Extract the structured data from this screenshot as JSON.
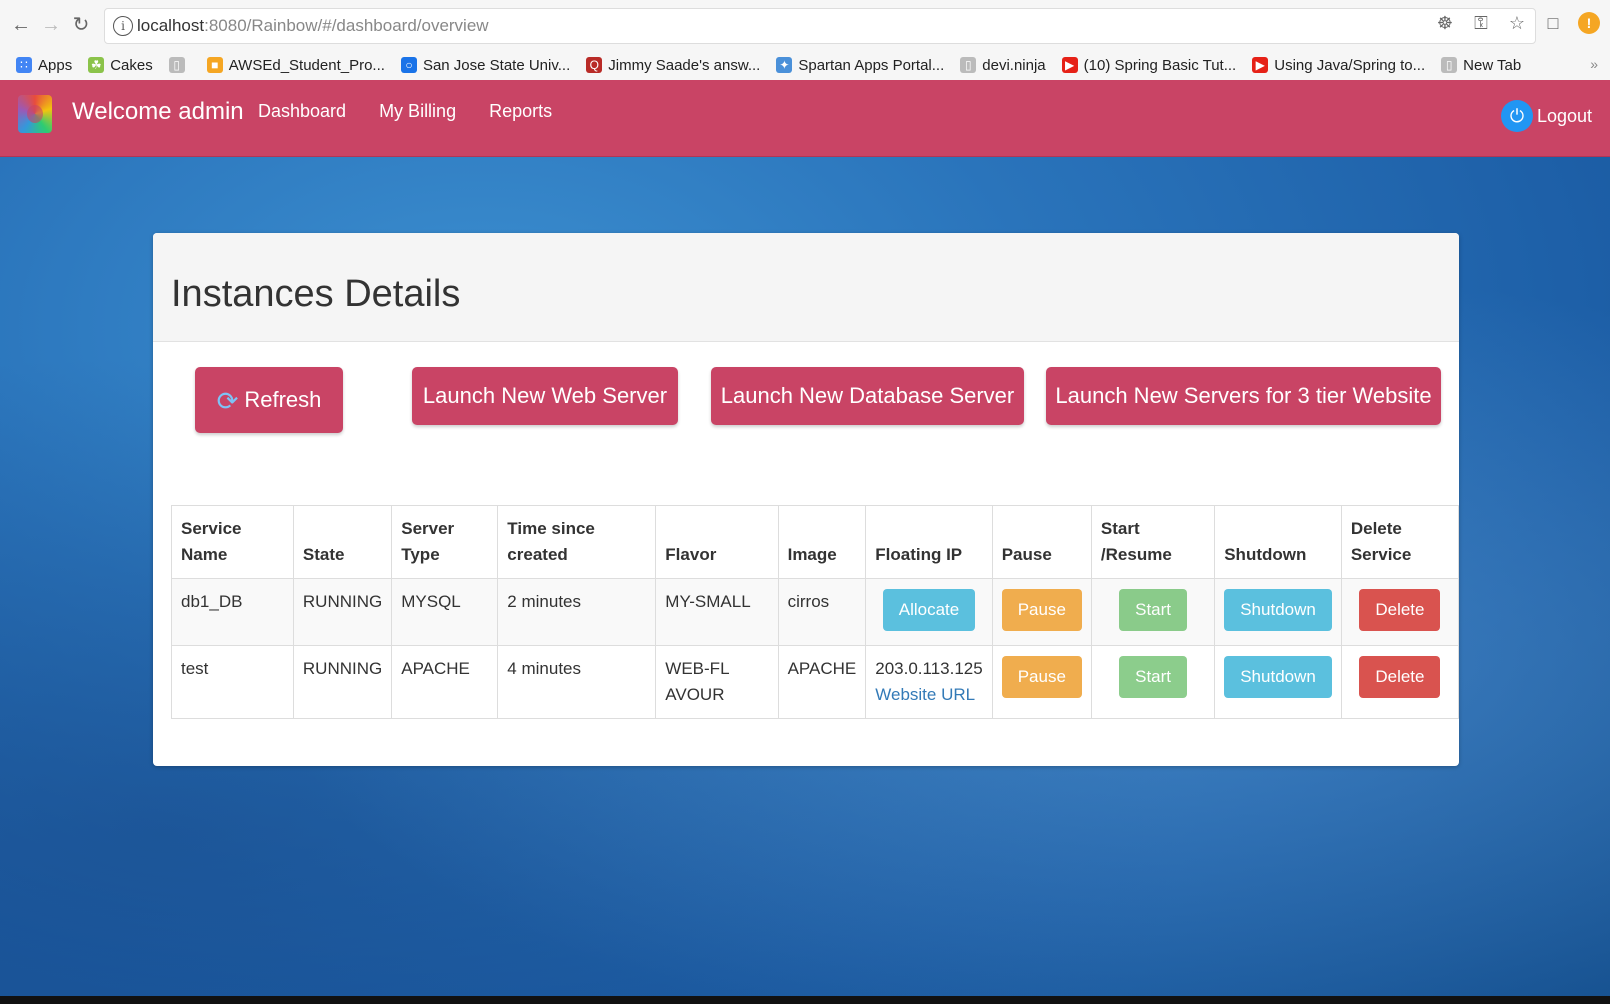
{
  "browser": {
    "url_host": "localhost",
    "url_path": ":8080/Rainbow/#/dashboard/overview",
    "bookmarks": [
      {
        "label": "Apps",
        "icon": "apps-grid-icon",
        "color": "#4285f4"
      },
      {
        "label": "Cakes",
        "icon": "leaf-icon",
        "color": "#8bc34a"
      },
      {
        "label": "",
        "icon": "page-icon",
        "color": "#bbbbbb"
      },
      {
        "label": "AWSEd_Student_Pro...",
        "icon": "box-icon",
        "color": "#f5a623"
      },
      {
        "label": "San Jose State Univ...",
        "icon": "circle-icon",
        "color": "#1a73e8"
      },
      {
        "label": "Jimmy Saade's answ...",
        "icon": "quora-icon",
        "color": "#b92b27"
      },
      {
        "label": "Spartan Apps Portal...",
        "icon": "spartan-icon",
        "color": "#4a90d9"
      },
      {
        "label": "devi.ninja",
        "icon": "page-icon",
        "color": "#bbbbbb"
      },
      {
        "label": "(10) Spring Basic Tut...",
        "icon": "youtube-icon",
        "color": "#e62117"
      },
      {
        "label": "Using Java/Spring to...",
        "icon": "youtube-icon",
        "color": "#e62117"
      },
      {
        "label": "New Tab",
        "icon": "page-icon",
        "color": "#bbbbbb"
      }
    ],
    "more": "»"
  },
  "header": {
    "brand": "Welcome admin",
    "nav": [
      "Dashboard",
      "My Billing",
      "Reports"
    ],
    "logout": "Logout"
  },
  "panel": {
    "title": "Instances Details",
    "buttons": {
      "refresh": "Refresh",
      "web": "Launch New Web Server",
      "db": "Launch New Database Server",
      "three_tier": "Launch New Servers for 3 tier Website"
    }
  },
  "table": {
    "headers": [
      "Service Name",
      "State",
      "Server Type",
      "Time since created",
      "Flavor",
      "Image",
      "Floating IP",
      "Pause",
      "Start /Resume",
      "Shutdown",
      "Delete Service"
    ],
    "rows": [
      {
        "service": "db1_DB",
        "state": "RUNNING",
        "type": "MYSQL",
        "time": "2 minutes",
        "flavor": "MY-SMALL",
        "image": "cirros",
        "floating_btn": "Allocate",
        "pause": "Pause",
        "start": "Start",
        "shutdown": "Shutdown",
        "delete": "Delete"
      },
      {
        "service": "test",
        "state": "RUNNING",
        "type": "APACHE",
        "time": "4 minutes",
        "flavor": "WEB-FLAVOUR",
        "image": "APACHE",
        "floating_ip": "203.0.113.125",
        "floating_link": "Website URL",
        "pause": "Pause",
        "start": "Start",
        "shutdown": "Shutdown",
        "delete": "Delete"
      }
    ]
  },
  "colors": {
    "appbar": "#c94465",
    "info": "#5bc0de",
    "warning": "#f0ad4e",
    "success": "#5cb85c",
    "danger": "#d9534f"
  }
}
